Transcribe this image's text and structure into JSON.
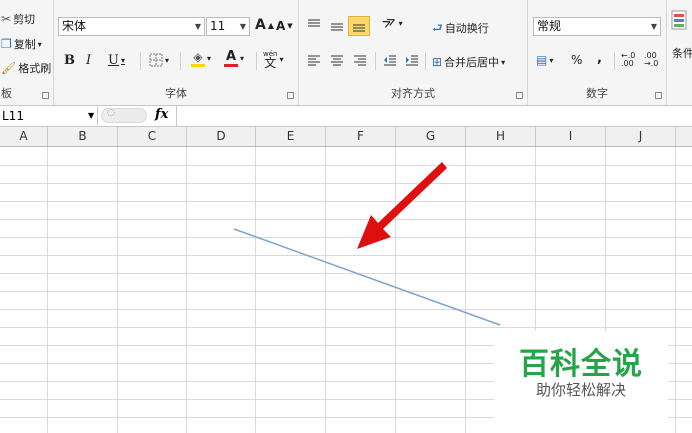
{
  "clipboard": {
    "cut_label": "剪切",
    "copy_label": "复制",
    "format_painter_label": "格式刷",
    "group_label": "板"
  },
  "font": {
    "name": "宋体",
    "size": "11",
    "grow_label": "A",
    "shrink_label": "A",
    "bold_label": "B",
    "italic_label": "I",
    "underline_label": "U",
    "font_color_label": "A",
    "phonetic_label": "wén",
    "group_label": "字体"
  },
  "alignment": {
    "wrap_text_label": "自动换行",
    "merge_center_label": "合并后居中",
    "group_label": "对齐方式"
  },
  "number": {
    "format": "常规",
    "percent_label": "%",
    "comma_label": ",",
    "inc_decimal_label": ".00",
    "dec_decimal_label": ".00",
    "group_label": "数字"
  },
  "styles": {
    "cut_label": "条件"
  },
  "formula_bar": {
    "cell_ref": "L11",
    "fx_label": "fx"
  },
  "columns": [
    "A",
    "B",
    "C",
    "D",
    "E",
    "F",
    "G",
    "H",
    "I",
    "J"
  ],
  "watermark": {
    "title": "百科全说",
    "subtitle": "助你轻松解决"
  },
  "colors": {
    "fill_yellow": "#ffd700",
    "font_red": "#e02020",
    "arrow_red": "#e00f0f",
    "line_blue": "#7da4cf",
    "watermark_green": "#27a34a"
  }
}
